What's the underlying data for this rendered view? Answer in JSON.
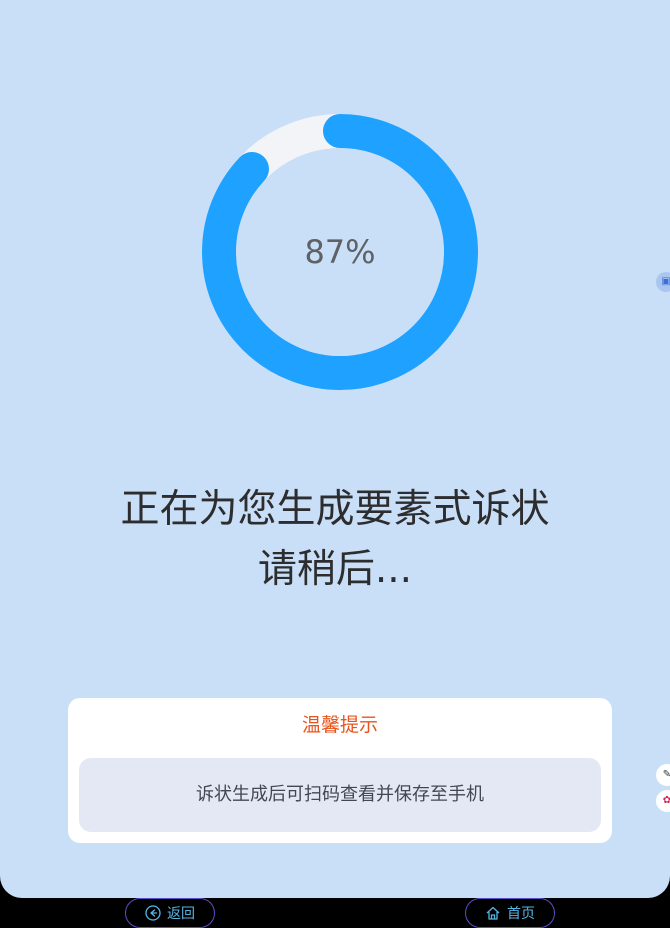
{
  "progress": {
    "percent": 87,
    "label": "87%",
    "track_color": "#f3f4f8",
    "fill_color": "#1fa1ff"
  },
  "status": {
    "line1": "正在为您生成要素式诉状",
    "line2": "请稍后..."
  },
  "tip": {
    "title": "温馨提示",
    "body": "诉状生成后可扫码查看并保存至手机"
  },
  "nav": {
    "back_label": "返回",
    "home_label": "首页",
    "back_icon": "arrow-left-circle-icon",
    "home_icon": "home-icon"
  },
  "colors": {
    "background": "#c9dff7",
    "tip_title": "#e8541b",
    "nav_text": "#56b6e6",
    "nav_border": "#5b4fc7"
  }
}
